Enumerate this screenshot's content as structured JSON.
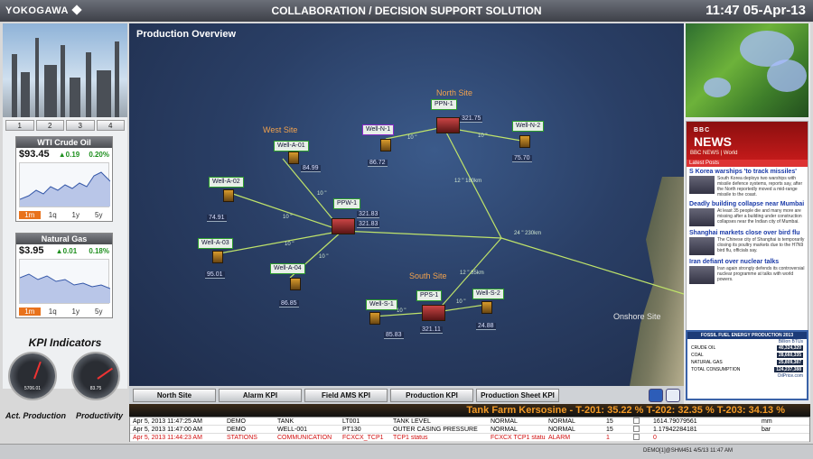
{
  "header": {
    "brand": "YOKOGAWA",
    "title": "COLLABORATION / DECISION SUPPORT SOLUTION",
    "clock": "11:47 05-Apr-13"
  },
  "left": {
    "tabs": [
      "1",
      "2",
      "3",
      "4"
    ],
    "wti": {
      "title": "WTI Crude Oil",
      "price": "$93.45",
      "change": "▲0.19",
      "pct": "0.20%",
      "ranges": [
        "1m",
        "1q",
        "1y",
        "5y"
      ],
      "active_range": "1m"
    },
    "gas": {
      "title": "Natural Gas",
      "price": "$3.95",
      "change": "▲0.01",
      "pct": "0.18%",
      "ranges": [
        "1m",
        "1q",
        "1y",
        "5y"
      ],
      "active_range": "1m"
    },
    "kpi_title": "KPI Indicators",
    "gauges": [
      {
        "label": "Act. Production",
        "value": "5706.01",
        "level": 0.62
      },
      {
        "label": "Productivity",
        "value": "83.75",
        "level": 0.84
      }
    ]
  },
  "map": {
    "title": "Production Overview",
    "sites": {
      "west": "West Site",
      "north": "North Site",
      "south": "South Site",
      "onshore": "Onshore Site"
    },
    "wells": {
      "wa01": {
        "name": "Well-A-01",
        "value": "84.99"
      },
      "wa02": {
        "name": "Well-A-02",
        "value": "74.91"
      },
      "wa03": {
        "name": "Well-A-03",
        "value": "95.01"
      },
      "wa04": {
        "name": "Well-A-04",
        "value": "86.85"
      },
      "wn1": {
        "name": "Well-N-1",
        "value": "86.72"
      },
      "wn2": {
        "name": "Well-N-2",
        "value": "75.70"
      },
      "ws1": {
        "name": "Well-S-1",
        "value": "85.83"
      },
      "ws2": {
        "name": "Well-S-2",
        "value": "24.88"
      }
    },
    "platforms": {
      "ppw1": {
        "name": "PPW-1",
        "value1": "321.83",
        "value2": "321.83"
      },
      "ppn1": {
        "name": "PPN-1",
        "value": "321.75"
      },
      "pps1": {
        "name": "PPS-1",
        "value": "321.11"
      }
    },
    "distances": {
      "n1": "10 \"",
      "n2": "10 \"",
      "w1": "10 \"",
      "w2": "10 \"",
      "w3": "10 \"",
      "w4": "10 \"",
      "trunk1": "12 \" 180km",
      "trunk2": "24 \" 230km",
      "south": "12 \" 85km",
      "s1": "10 \"",
      "s2": "10 \""
    }
  },
  "buttons": [
    "North Site",
    "Alarm KPI",
    "Field AMS KPI",
    "Production KPI",
    "Production Sheet KPI"
  ],
  "news": {
    "brand": "BBC",
    "logo": "NEWS",
    "section": "BBC NEWS | World",
    "latest": "Latest Posts",
    "stories": [
      {
        "headline": "S Korea warships 'to track missiles'",
        "body": "South Korea deploys two warships with missile defence systems, reports say, after the North reportedly moved a mid-range missile to the coast."
      },
      {
        "headline": "Deadly building collapse near Mumbai",
        "body": "At least 35 people die and many more are missing after a building under construction collapses near the Indian city of Mumbai."
      },
      {
        "headline": "Shanghai markets close over bird flu",
        "body": "The Chinese city of Shanghai is temporarily closing its poultry markets due to the H7N9 bird flu, officials say."
      },
      {
        "headline": "Iran defiant over nuclear talks",
        "body": "Iran again strongly defends its controversial nuclear programme at talks with world powers."
      }
    ],
    "production": {
      "title": "FOSSIL FUEL ENERGY PRODUCTION 2013",
      "unit": "Billion BTUs",
      "rows": [
        {
          "label": "CRUDE OIL",
          "value": "40,324,320"
        },
        {
          "label": "COAL",
          "value": "28,660,335"
        },
        {
          "label": "NATURAL GAS",
          "value": "25,809,387"
        },
        {
          "label": "TOTAL CONSUMPTION",
          "value": "124,237,388"
        }
      ],
      "source": "OilPrice.com"
    }
  },
  "ticker": "Tank Farm Kersosine - T-201: 35.22 %  T-202: 32.35 %  T-203: 34.13 %",
  "alarms": [
    {
      "time": "Apr 5, 2013 11:47:25 AM",
      "user": "DEMO",
      "unit": "TANK",
      "tag": "LT001",
      "desc": "TANK LEVEL",
      "s1": "NORMAL",
      "s2": "NORMAL",
      "pri": "15",
      "val": "1614.79079561",
      "eu": "mm",
      "red": false
    },
    {
      "time": "Apr 5, 2013 11:47:00 AM",
      "user": "DEMO",
      "unit": "WELL-001",
      "tag": "PT130",
      "desc": "OUTER CASING PRESSURE",
      "s1": "NORMAL",
      "s2": "NORMAL",
      "pri": "15",
      "val": "1.17942284181",
      "eu": "bar",
      "red": false
    },
    {
      "time": "Apr 5, 2013 11:44:23 AM",
      "user": "STATIONS",
      "unit": "COMMUNICATION",
      "tag": "FCXCX_TCP1",
      "desc": "TCP1 status",
      "s1": "FCXCX TCP1 status",
      "s2": "ALARM",
      "pri": "1",
      "val": "0",
      "eu": "",
      "red": true
    }
  ],
  "status": "DEMO[1]@SHM451 4/5/13 11:47 AM"
}
